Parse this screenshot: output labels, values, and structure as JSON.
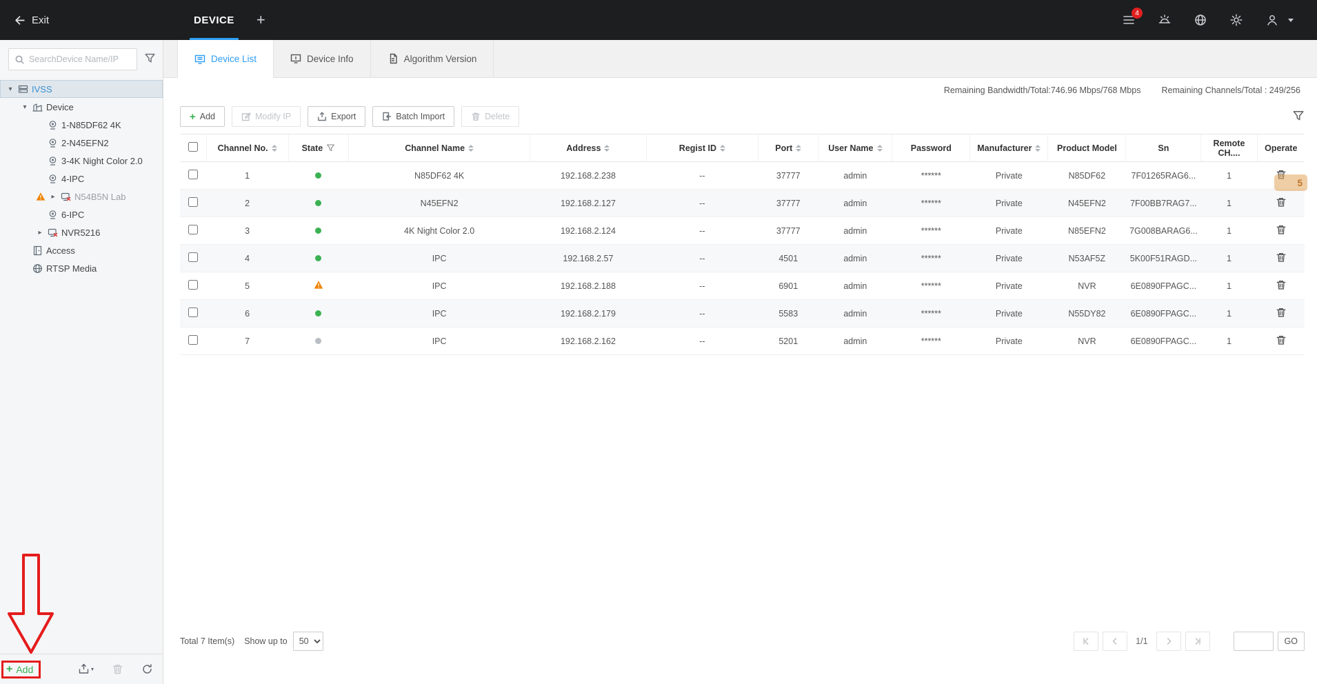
{
  "colors": {
    "accent": "#2e9df2",
    "success": "#3cb152",
    "warning": "#f08300",
    "annotation": "#e51c1c",
    "offline": "#b9bec4",
    "badge": "#e02020"
  },
  "topbar": {
    "exit_label": "Exit",
    "device_tab": "DEVICE",
    "new_tab_label": "+",
    "notification_badge": "4"
  },
  "sidebar": {
    "search_placeholder": "SearchDevice Name/IP",
    "tree": [
      {
        "label": "IVSS",
        "level": 0,
        "caret": "down",
        "icon": "server-icon",
        "selected": true,
        "trailing": "panel-icon"
      },
      {
        "label": "Device",
        "level": 1,
        "caret": "down",
        "icon": "building-icon"
      },
      {
        "label": "1-N85DF62 4K",
        "level": 2,
        "icon": "camera-icon"
      },
      {
        "label": "2-N45EFN2",
        "level": 2,
        "icon": "camera-icon"
      },
      {
        "label": "3-4K Night Color 2.0",
        "level": 2,
        "icon": "camera-icon"
      },
      {
        "label": "4-IPC",
        "level": 2,
        "icon": "camera-icon"
      },
      {
        "label": "N54B5N Lab",
        "level": 2,
        "caret": "right",
        "icon": "device-offline-icon",
        "warning": true,
        "muted": true
      },
      {
        "label": "6-IPC",
        "level": 2,
        "icon": "camera-icon"
      },
      {
        "label": "NVR5216",
        "level": 2,
        "caret": "right",
        "icon": "device-offline-icon"
      },
      {
        "label": "Access",
        "level": 1,
        "icon": "access-icon"
      },
      {
        "label": "RTSP Media",
        "level": 1,
        "icon": "rtsp-icon"
      }
    ],
    "footer": {
      "add_label": "Add"
    }
  },
  "tabs": [
    {
      "label": "Device List",
      "icon": "device-list-icon",
      "active": true
    },
    {
      "label": "Device Info",
      "icon": "device-info-icon",
      "active": false
    },
    {
      "label": "Algorithm Version",
      "icon": "algorithm-icon",
      "active": false
    }
  ],
  "stats": {
    "bandwidth_label": "Remaining Bandwidth/Total:746.96 Mbps/768 Mbps",
    "channels_label": "Remaining Channels/Total : 249/256"
  },
  "toolbar": {
    "buttons": [
      {
        "label": "Add",
        "icon": "plus-icon",
        "enabled": true
      },
      {
        "label": "Modify IP",
        "icon": "edit-icon",
        "enabled": false
      },
      {
        "label": "Export",
        "icon": "export-icon",
        "enabled": true
      },
      {
        "label": "Batch Import",
        "icon": "import-icon",
        "enabled": true
      },
      {
        "label": "Delete",
        "icon": "trash-icon",
        "enabled": false
      }
    ]
  },
  "table": {
    "columns": [
      "",
      "Channel No.",
      "State",
      "Channel Name",
      "Address",
      "Regist ID",
      "Port",
      "User Name",
      "Password",
      "Manufacturer",
      "Product Model",
      "Sn",
      "Remote CH....",
      "Operate"
    ],
    "rows": [
      {
        "channel_no": "1",
        "state": "online",
        "channel_name": "N85DF62 4K",
        "address": "192.168.2.238",
        "regist_id": "--",
        "port": "37777",
        "user_name": "admin",
        "password": "******",
        "manufacturer": "Private",
        "product_model": "N85DF62",
        "sn": "7F01265RAG6...",
        "remote_ch": "1"
      },
      {
        "channel_no": "2",
        "state": "online",
        "channel_name": "N45EFN2",
        "address": "192.168.2.127",
        "regist_id": "--",
        "port": "37777",
        "user_name": "admin",
        "password": "******",
        "manufacturer": "Private",
        "product_model": "N45EFN2",
        "sn": "7F00BB7RAG7...",
        "remote_ch": "1"
      },
      {
        "channel_no": "3",
        "state": "online",
        "channel_name": "4K Night Color 2.0",
        "address": "192.168.2.124",
        "regist_id": "--",
        "port": "37777",
        "user_name": "admin",
        "password": "******",
        "manufacturer": "Private",
        "product_model": "N85EFN2",
        "sn": "7G008BARAG6...",
        "remote_ch": "1"
      },
      {
        "channel_no": "4",
        "state": "online",
        "channel_name": "IPC",
        "address": "192.168.2.57",
        "regist_id": "--",
        "port": "4501",
        "user_name": "admin",
        "password": "******",
        "manufacturer": "Private",
        "product_model": "N53AF5Z",
        "sn": "5K00F51RAGD...",
        "remote_ch": "1"
      },
      {
        "channel_no": "5",
        "state": "warning",
        "channel_name": "IPC",
        "address": "192.168.2.188",
        "regist_id": "--",
        "port": "6901",
        "user_name": "admin",
        "password": "******",
        "manufacturer": "Private",
        "product_model": "NVR",
        "sn": "6E0890FPAGC...",
        "remote_ch": "1"
      },
      {
        "channel_no": "6",
        "state": "online",
        "channel_name": "IPC",
        "address": "192.168.2.179",
        "regist_id": "--",
        "port": "5583",
        "user_name": "admin",
        "password": "******",
        "manufacturer": "Private",
        "product_model": "N55DY82",
        "sn": "6E0890FPAGC...",
        "remote_ch": "1"
      },
      {
        "channel_no": "7",
        "state": "offline",
        "channel_name": "IPC",
        "address": "192.168.2.162",
        "regist_id": "--",
        "port": "5201",
        "user_name": "admin",
        "password": "******",
        "manufacturer": "Private",
        "product_model": "NVR",
        "sn": "6E0890FPAGC...",
        "remote_ch": "1"
      }
    ]
  },
  "footer": {
    "total_label": "Total 7 Item(s)",
    "show_up_to_label": "Show up to",
    "page_size": "50",
    "page_indicator": "1/1",
    "go_label": "GO"
  },
  "annotations": {
    "step_badge": "5"
  }
}
